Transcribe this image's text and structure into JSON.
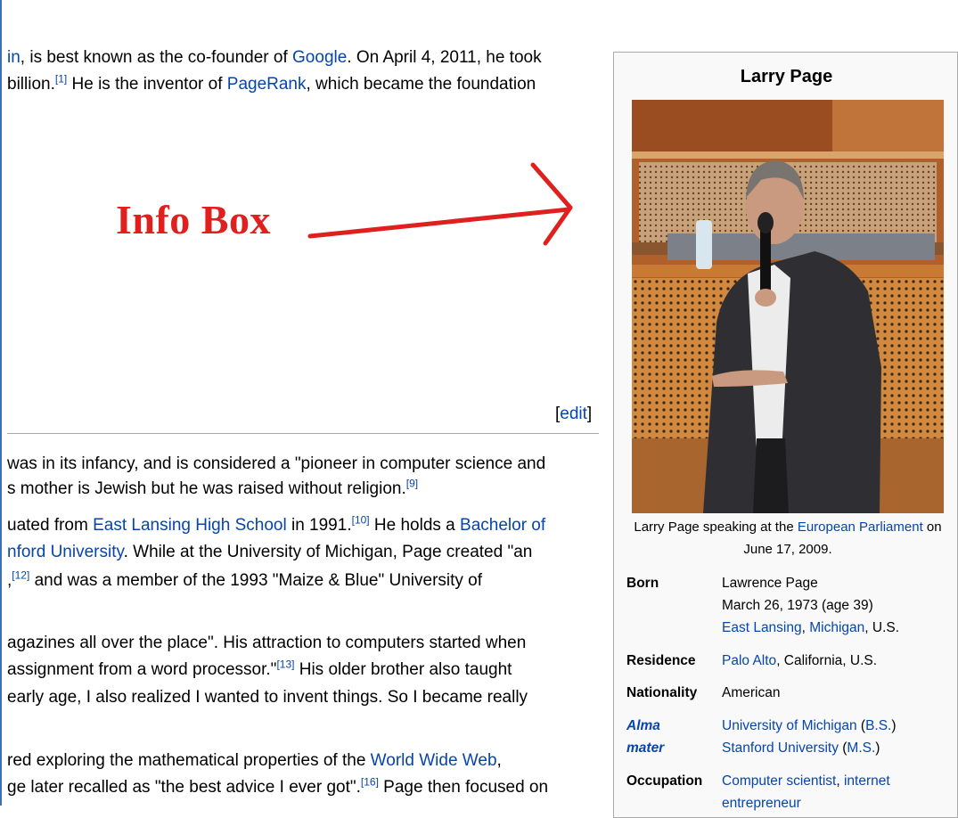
{
  "article": {
    "lines": [
      {
        "parts": [
          {
            "t": "in",
            "link": true
          },
          {
            "t": ", is best known as the co-founder of "
          },
          {
            "t": "Google",
            "link": true
          },
          {
            "t": ". On April 4, 2011, he took"
          }
        ]
      },
      {
        "parts": [
          {
            "t": "billion."
          },
          {
            "t": "[1]",
            "sup": true
          },
          {
            "t": " He is the inventor of "
          },
          {
            "t": "PageRank",
            "link": true
          },
          {
            "t": ", which became the foundation"
          }
        ]
      },
      {
        "parts": [
          {
            "t": "was in its infancy, and is considered a \"pioneer in computer science and"
          }
        ]
      },
      {
        "parts": [
          {
            "t": "s mother is Jewish but he was raised without religion."
          },
          {
            "t": "[9]",
            "sup": true
          }
        ]
      },
      {
        "parts": [
          {
            "t": "uated from "
          },
          {
            "t": "East Lansing High School",
            "link": true
          },
          {
            "t": " in 1991."
          },
          {
            "t": "[10]",
            "sup": true
          },
          {
            "t": " He holds a "
          },
          {
            "t": "Bachelor of",
            "link": true
          }
        ]
      },
      {
        "parts": [
          {
            "t": "nford University",
            "link": true
          },
          {
            "t": ". While at the University of Michigan, Page created \"an"
          }
        ]
      },
      {
        "parts": [
          {
            "t": ","
          },
          {
            "t": "[12]",
            "sup": true
          },
          {
            "t": " and was a member of the 1993 \"Maize & Blue\" University of"
          }
        ]
      },
      {
        "parts": [
          {
            "t": "agazines all over the place\". His attraction to computers started when"
          }
        ]
      },
      {
        "parts": [
          {
            "t": " assignment from a word processor.\""
          },
          {
            "t": "[13]",
            "sup": true
          },
          {
            "t": " His older brother also taught"
          }
        ]
      },
      {
        "parts": [
          {
            "t": " early age, I also realized I wanted to invent things. So I became really"
          }
        ]
      },
      {
        "parts": [
          {
            "t": "red exploring the mathematical properties of the "
          },
          {
            "t": "World Wide Web",
            "link": true
          },
          {
            "t": ","
          }
        ]
      },
      {
        "parts": [
          {
            "t": "ge later recalled as \"the best advice I ever got\"."
          },
          {
            "t": "[16]",
            "sup": true
          },
          {
            "t": " Page then focused on"
          }
        ]
      }
    ],
    "edit_label": "edit",
    "edit_open": "[",
    "edit_close": "]"
  },
  "annotation": {
    "label": "Info Box",
    "color": "#e0201e"
  },
  "infobox": {
    "title": "Larry Page",
    "caption_pre": "Larry Page speaking at the ",
    "caption_link": "European Parliament",
    "caption_post": " on June 17, 2009.",
    "rows": [
      {
        "key": "Born",
        "values": [
          [
            {
              "t": "Lawrence Page"
            }
          ],
          [
            {
              "t": "March 26, 1973 (age 39)"
            }
          ],
          [
            {
              "t": "East Lansing",
              "link": true
            },
            {
              "t": ", "
            },
            {
              "t": "Michigan",
              "link": true
            },
            {
              "t": ", U.S."
            }
          ]
        ]
      },
      {
        "key": "Residence",
        "values": [
          [
            {
              "t": "Palo Alto",
              "link": true
            },
            {
              "t": ", California, U.S."
            }
          ]
        ]
      },
      {
        "key": "Nationality",
        "values": [
          [
            {
              "t": "American"
            }
          ]
        ]
      },
      {
        "key": "Alma mater",
        "key_lines": [
          "Alma",
          "mater"
        ],
        "key_link": true,
        "values": [
          [
            {
              "t": "University of Michigan",
              "link": true
            },
            {
              "t": " ("
            },
            {
              "t": "B.S.",
              "link": true
            },
            {
              "t": ")"
            }
          ],
          [
            {
              "t": "Stanford University",
              "link": true
            },
            {
              "t": " ("
            },
            {
              "t": "M.S.",
              "link": true
            },
            {
              "t": ")"
            }
          ]
        ]
      },
      {
        "key": "Occupation",
        "values": [
          [
            {
              "t": "Computer scientist",
              "link": true
            },
            {
              "t": ", "
            },
            {
              "t": "internet",
              "link": true
            }
          ],
          [
            {
              "t": "entrepreneur",
              "link": true
            }
          ]
        ]
      }
    ]
  },
  "colors": {
    "link": "#0645ad",
    "annotation": "#e0201e",
    "infobox_bg": "#f9f9f9"
  }
}
